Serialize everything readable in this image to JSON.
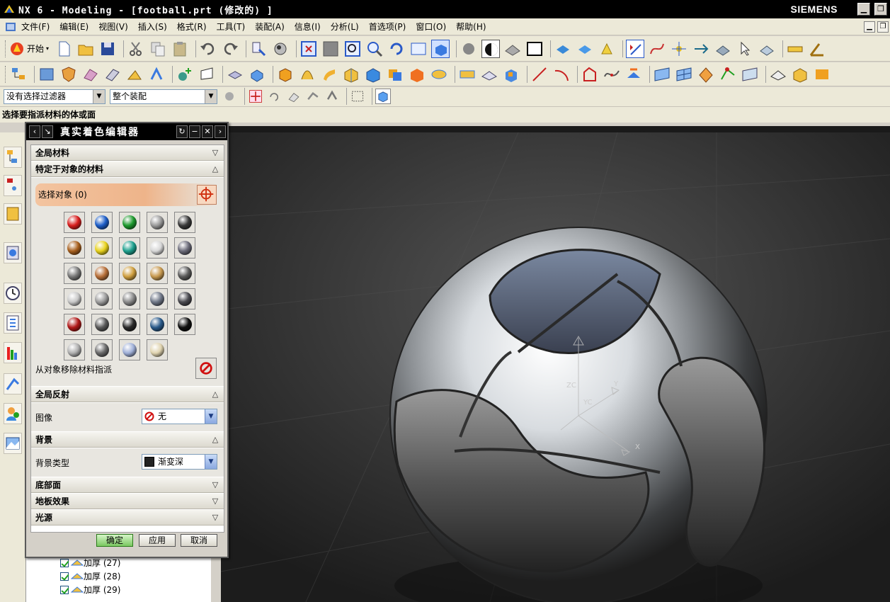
{
  "window": {
    "title": "NX 6 - Modeling - [football.prt (修改的) ]",
    "brand": "SIEMENS",
    "min_glyph": "▁",
    "max_glyph": "❐"
  },
  "menu": [
    "文件(F)",
    "编辑(E)",
    "视图(V)",
    "插入(S)",
    "格式(R)",
    "工具(T)",
    "装配(A)",
    "信息(I)",
    "分析(L)",
    "首选项(P)",
    "窗口(O)",
    "帮助(H)"
  ],
  "toolbar": {
    "start_label": "开始",
    "filter_value": "没有选择过滤器",
    "scope_value": "整个装配"
  },
  "cue_line": "选择要指派材料的体或面",
  "dialog": {
    "title": "真实着色编辑器",
    "sections": {
      "global_material": "全局材料",
      "object_material": "特定于对象的材料",
      "global_reflection": "全局反射",
      "background": "背景",
      "base": "底部面",
      "floor_effect": "地板效果",
      "light": "光源"
    },
    "select_object": "选择对象 (0)",
    "remove_label": "从对象移除材料指派",
    "image_label": "图像",
    "image_value": "无",
    "bg_type_label": "背景类型",
    "bg_type_value": "渐变深",
    "ok": "确定",
    "apply": "应用",
    "cancel": "取消"
  },
  "materials": [
    "#d81e1e",
    "#1e5ec8",
    "#1e9a2e",
    "#9a9a9a",
    "#3a3a3a",
    "#a8601e",
    "#e8d21e",
    "#1ea08e",
    "#d8d8d8",
    "#6a6a78",
    "#787878",
    "#b8703a",
    "#d0a040",
    "#c89a50",
    "#5a5a5a",
    "#c8c8c8",
    "#9c9c9c",
    "#8a8a8a",
    "#707888",
    "#4a4a50",
    "#b01818",
    "#5a5a5a",
    "#2a2a2a",
    "#2a5a8a",
    "#101010",
    "#b0b0b0",
    "#6a6a6a",
    "#a0b0d8",
    "#e0d4b0"
  ],
  "nav_tree": [
    {
      "label": "加厚 (27)"
    },
    {
      "label": "加厚 (28)"
    },
    {
      "label": "加厚 (29)"
    }
  ],
  "csys_labels": {
    "x": "X",
    "y": "Y",
    "zc": "ZC",
    "yc": "YC"
  }
}
